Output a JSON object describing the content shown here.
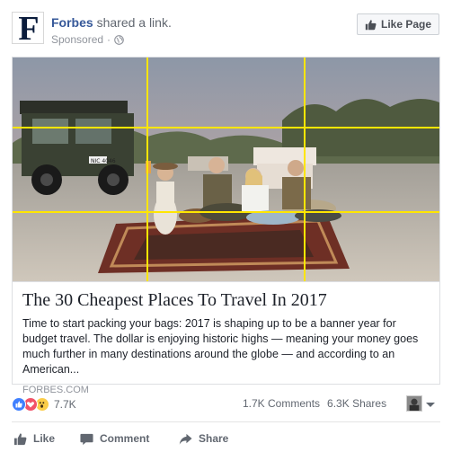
{
  "post": {
    "author": "Forbes",
    "action_text": "shared a link.",
    "sponsored_label": "Sponsored",
    "logo_letter": "F",
    "like_page_label": "Like Page"
  },
  "attachment": {
    "headline": "The 30 Cheapest Places To Travel In 2017",
    "description": "Time to start packing your bags: 2017 is shaping up to be a banner year for budget travel. The dollar is enjoying historic highs — meaning your money goes much further in many destinations around the globe — and according to an American...",
    "domain": "FORBES.COM",
    "plate_text": "NIC 4046"
  },
  "engagement": {
    "reaction_count": "7.7K",
    "comments": "1.7K Comments",
    "shares": "6.3K Shares",
    "reaction_icons": [
      "like-reaction-icon",
      "love-reaction-icon",
      "wow-reaction-icon"
    ]
  },
  "actions": {
    "like_label": "Like",
    "comment_label": "Comment",
    "share_label": "Share"
  },
  "colors": {
    "link_blue": "#365899",
    "like_blue": "#4080ff",
    "love_red": "#f25268",
    "wow_yellow": "#fbcd49",
    "grid_yellow": "#ffe600",
    "secondary_text": "#616770"
  }
}
